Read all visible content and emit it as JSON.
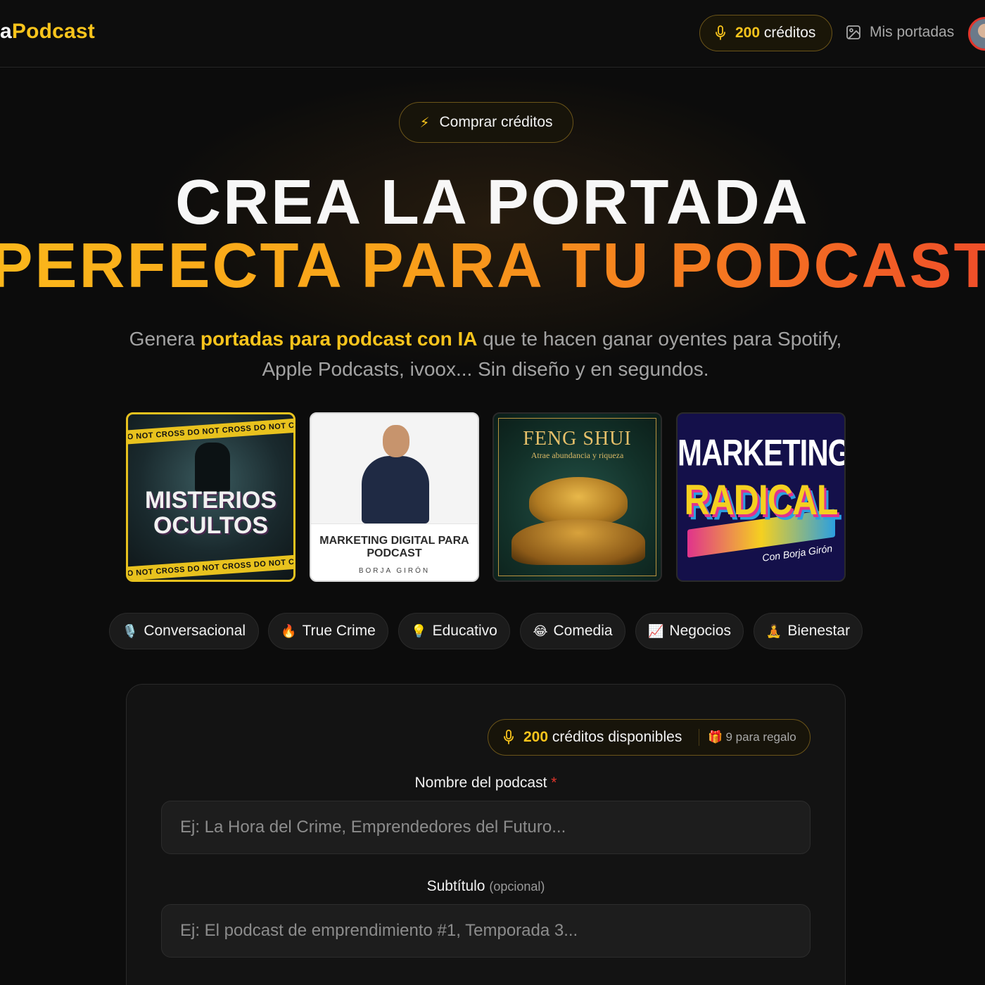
{
  "header": {
    "logo_prefix": "a",
    "logo_suffix": "Podcast",
    "credits_count": "200",
    "credits_label": "créditos",
    "my_covers_label": "Mis portadas"
  },
  "buy_button": {
    "label": "Comprar créditos"
  },
  "hero": {
    "line1": "CREA LA PORTADA",
    "line2": "PERFECTA PARA TU PODCAST"
  },
  "subtitle": {
    "pre": "Genera ",
    "highlight": "portadas para podcast con IA",
    "post": " que te hacen ganar oyentes para Spotify, Apple Podcasts, ivoox... Sin diseño y en segundos."
  },
  "covers": [
    {
      "title": "MISTERIOS OCULTOS",
      "tape": "DO NOT CROSS  DO NOT CROSS  DO NOT CROSS  DO NOT CROSS"
    },
    {
      "title": "MARKETING DIGITAL PARA PODCAST",
      "author": "BORJA GIRÓN"
    },
    {
      "title": "FENG SHUI",
      "subtitle": "Atrae abundancia y riqueza"
    },
    {
      "title_top": "MARKETING",
      "title_bottom": "RADICAL",
      "byline": "Con Borja Girón"
    }
  ],
  "categories": [
    {
      "emoji": "🎙️",
      "label": "Conversacional"
    },
    {
      "emoji": "🔥",
      "label": "True Crime"
    },
    {
      "emoji": "💡",
      "label": "Educativo"
    },
    {
      "emoji": "😂",
      "label": "Comedia"
    },
    {
      "emoji": "📈",
      "label": "Negocios"
    },
    {
      "emoji": "🧘",
      "label": "Bienestar"
    }
  ],
  "form": {
    "credits_count": "200",
    "credits_label": "créditos disponibles",
    "gift_emoji": "🎁",
    "gift_label": "9 para regalo",
    "name_label": "Nombre del podcast",
    "name_required": "*",
    "name_placeholder": "Ej: La Hora del Crime, Emprendedores del Futuro...",
    "subtitle_label": "Subtítulo",
    "subtitle_optional": "(opcional)",
    "subtitle_placeholder": "Ej: El podcast de emprendimiento #1, Temporada 3..."
  },
  "colors": {
    "accent": "#f8c41c",
    "gradient_start": "#fbb81b",
    "gradient_end": "#ef4a2a",
    "background": "#0c0c0c",
    "required": "#e2352b"
  }
}
